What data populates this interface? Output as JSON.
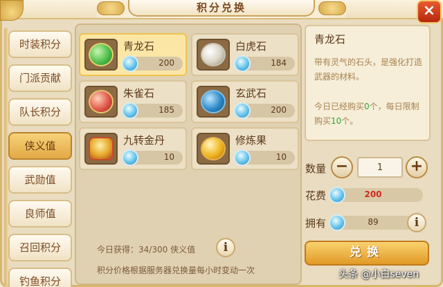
{
  "header": {
    "title": "积分兑换",
    "close_label": "×"
  },
  "sidebar": {
    "tabs": [
      {
        "label": "时装积分",
        "active": false
      },
      {
        "label": "门派贡献",
        "active": false
      },
      {
        "label": "队长积分",
        "active": false
      },
      {
        "label": "侠义值",
        "active": true
      },
      {
        "label": "武勋值",
        "active": false
      },
      {
        "label": "良师值",
        "active": false
      },
      {
        "label": "召回积分",
        "active": false
      },
      {
        "label": "钓鱼积分",
        "active": false
      }
    ]
  },
  "items": [
    {
      "name": "青龙石",
      "price": "200",
      "icon": "azure-dragon-stone-icon",
      "color": "#4fbf4a",
      "selected": true
    },
    {
      "name": "白虎石",
      "price": "184",
      "icon": "white-tiger-stone-icon",
      "color": "#d9d4c4",
      "selected": false
    },
    {
      "name": "朱雀石",
      "price": "185",
      "icon": "vermilion-bird-stone-icon",
      "color": "#e0574a",
      "selected": false
    },
    {
      "name": "玄武石",
      "price": "200",
      "icon": "black-tortoise-stone-icon",
      "color": "#2c8ac9",
      "selected": false
    },
    {
      "name": "九转金丹",
      "price": "10",
      "icon": "golden-elixir-icon",
      "color": "#e6a629",
      "selected": false
    },
    {
      "name": "修炼果",
      "price": "10",
      "icon": "cultivation-fruit-icon",
      "color": "#f0b51f",
      "selected": false
    }
  ],
  "footer": {
    "today_label": "今日获得：",
    "today_value": "34/300",
    "today_unit": "侠义值",
    "note": "积分价格根据服务器兑换量每小时变动一次"
  },
  "detail": {
    "title": "青龙石",
    "description": "带有灵气的石头，是强化打造武器的材料。",
    "limit_prefix": "今日已经购买",
    "bought": "0",
    "limit_mid": "个，每日限制购买",
    "limit": "10",
    "limit_suffix": "个。"
  },
  "purchase": {
    "qty_label": "数量",
    "qty_value": "1",
    "minus_label": "−",
    "plus_label": "+",
    "cost_label": "花费",
    "cost_value": "200",
    "owned_label": "拥有",
    "owned_value": "89",
    "info_label": "i",
    "exchange_label": "兑换"
  },
  "watermark": "头条 @小白seven"
}
